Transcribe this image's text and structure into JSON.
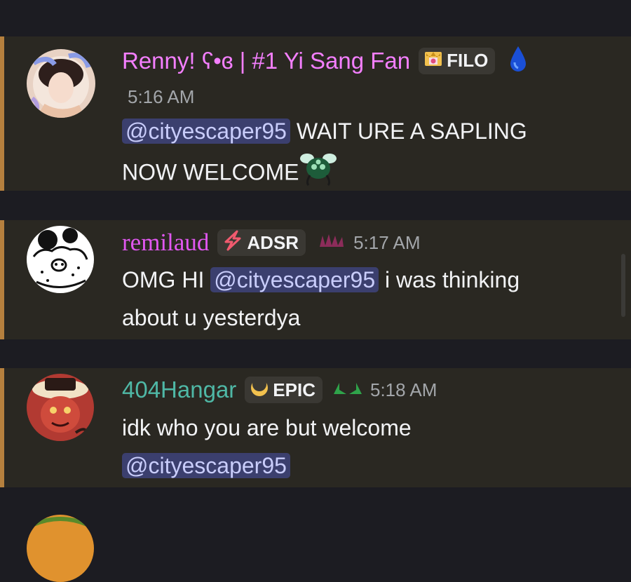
{
  "messages": [
    {
      "username": "Renny! ʕ•ɞ | #1 Yi Sang Fan",
      "username_color": "#f47fff",
      "tag_label": "FILO",
      "time": "5:16 AM",
      "mention": "@cityescaper95",
      "text_line1": "WAIT URE A SAPLING",
      "text_line2": "NOW WELCOME"
    },
    {
      "username": "remilaud",
      "username_color": "#e057f0",
      "tag_label": "ADSR",
      "time": "5:17 AM",
      "text_prefix": "OMG HI",
      "mention": "@cityescaper95",
      "text_suffix": "i was thinking",
      "text_line2": "about u yesterdya"
    },
    {
      "username": "404Hangar",
      "username_color": "#4fb8a6",
      "tag_label": "EPIC",
      "time": "5:18 AM",
      "text_line1": "idk who you are but welcome",
      "mention": "@cityescaper95"
    }
  ]
}
